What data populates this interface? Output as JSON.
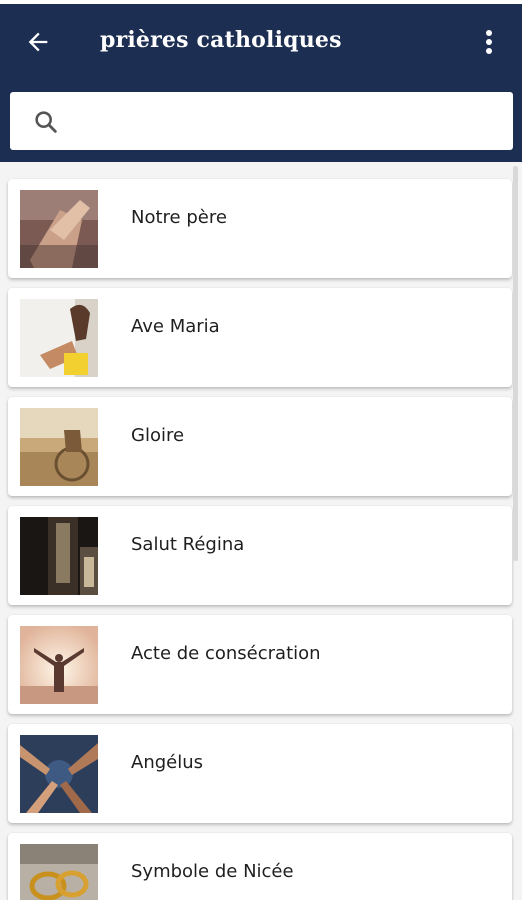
{
  "app_bar": {
    "title": "prières catholiques",
    "background_color": "#1c2e52",
    "back_icon": "arrow-left-icon",
    "menu_icon": "more-vert-icon"
  },
  "search": {
    "placeholder": "",
    "value": "",
    "icon": "search-icon"
  },
  "prayers": [
    {
      "label": "Notre père",
      "thumbnail": "praying-hands-image"
    },
    {
      "label": "Ave Maria",
      "thumbnail": "kneeling-prayer-image"
    },
    {
      "label": "Gloire",
      "thumbnail": "wheelchair-field-image"
    },
    {
      "label": "Salut Régina",
      "thumbnail": "church-interior-image"
    },
    {
      "label": "Acte de consécration",
      "thumbnail": "open-arms-sunset-image"
    },
    {
      "label": "Angélus",
      "thumbnail": "group-hands-image"
    },
    {
      "label": "Symbole de Nicée",
      "thumbnail": "wedding-rings-image"
    }
  ]
}
